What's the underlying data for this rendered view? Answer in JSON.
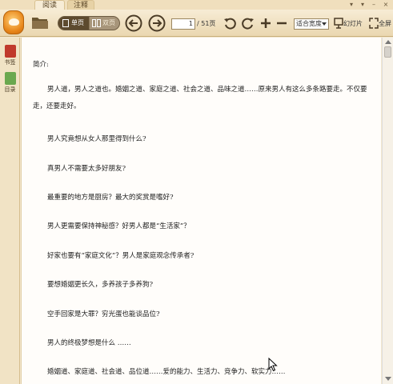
{
  "tabs": {
    "read": "阅读",
    "note": "注释"
  },
  "toolbar": {
    "view_single": "单页",
    "view_double": "双页",
    "page_current": "1",
    "page_total": "/ 51页",
    "zoom": "适合宽度",
    "slideshow": "幻灯片",
    "fullscreen": "全屏"
  },
  "sidebar": {
    "bookmarks": "书签",
    "contents": "目录"
  },
  "document": {
    "heading": "简介:",
    "paragraph1": "男人道，男人之道也。婚姻之道、家庭之道、社会之道、品味之道……原来男人有这么多条路要走。不仅要走，还要走好。",
    "lines": [
      "男人究竟想从女人那里得到什么?",
      "真男人不需要太多好朋友?",
      "最重要的地方是厨房？最大的奖赏是嗜好?",
      "男人更需要保持神秘感？好男人都是“生活家”？",
      "好家也要有“家庭文化”？男人是家庭观念传承者?",
      "要想婚姻更长久，多养孩子多养狗?",
      "空手回家是大罪？穷光蛋也能谈品位?",
      "男人的终极梦想是什么 ……",
      "婚姻道、家庭道、社会道、品位道……爱的能力、生活力、竞争力、软实力……"
    ]
  },
  "colors": {
    "toolbar_top": "#f7ecd5",
    "toolbar_bottom": "#ead7b0",
    "accent_orange": "#e8861a",
    "page_bg": "#fffdfa"
  }
}
